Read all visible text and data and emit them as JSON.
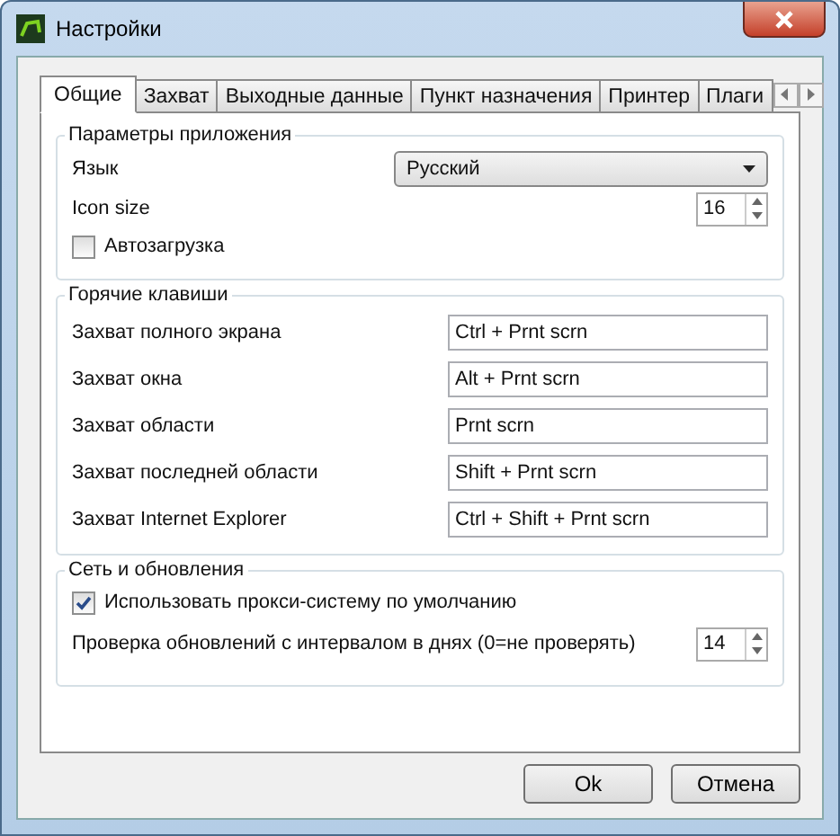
{
  "window": {
    "title": "Настройки"
  },
  "tabs": [
    {
      "label": "Общие",
      "selected": true
    },
    {
      "label": "Захват",
      "selected": false
    },
    {
      "label": "Выходные данные",
      "selected": false
    },
    {
      "label": "Пункт назначения",
      "selected": false
    },
    {
      "label": "Принтер",
      "selected": false
    },
    {
      "label": "Плаги",
      "selected": false
    }
  ],
  "app_settings": {
    "title": "Параметры приложения",
    "language_label": "Язык",
    "language_value": "Русский",
    "icon_size_label": "Icon size",
    "icon_size_value": "16",
    "autostart": {
      "label": "Автозагрузка",
      "checked": false
    }
  },
  "hotkeys": {
    "title": "Горячие клавиши",
    "rows": [
      {
        "label": "Захват полного экрана",
        "value": "Ctrl + Prnt scrn"
      },
      {
        "label": "Захват окна",
        "value": "Alt + Prnt scrn"
      },
      {
        "label": "Захват области",
        "value": "Prnt scrn"
      },
      {
        "label": "Захват последней области",
        "value": "Shift + Prnt scrn"
      },
      {
        "label": "Захват Internet Explorer",
        "value": "Ctrl + Shift + Prnt scrn"
      }
    ]
  },
  "network": {
    "title": "Сеть и обновления",
    "proxy": {
      "label": "Использовать прокси-систему по умолчанию",
      "checked": true
    },
    "update_label": "Проверка обновлений с интервалом в днях (0=не проверять)",
    "update_value": "14"
  },
  "buttons": [
    "Ok",
    "Отмена"
  ]
}
